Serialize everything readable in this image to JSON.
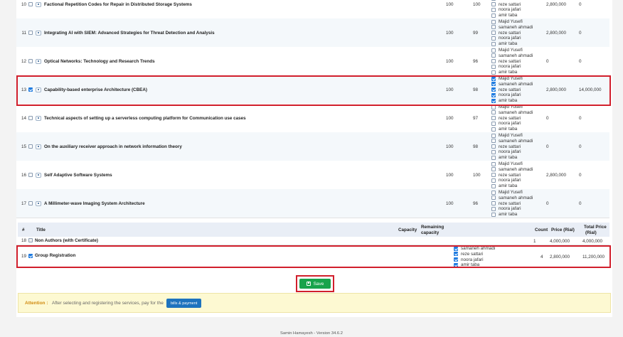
{
  "services": [
    {
      "num": "10",
      "checked": false,
      "title": "Factional Repetition Codes for Repair in Distributed Storage Systems",
      "capacity": "100",
      "remaining": "100",
      "price": "2,800,000",
      "total": "0"
    },
    {
      "num": "11",
      "checked": false,
      "title": "Integrating AI with SIEM: Advanced Strategies for Threat Detection and Analysis",
      "capacity": "100",
      "remaining": "99",
      "price": "2,800,000",
      "total": "0"
    },
    {
      "num": "12",
      "checked": false,
      "title": "Optical Networks: Technology and Research Trends",
      "capacity": "100",
      "remaining": "96",
      "price": "0",
      "total": "0"
    },
    {
      "num": "13",
      "checked": true,
      "title": "Capability-based enterprise Architecture (CBEA)",
      "capacity": "100",
      "remaining": "98",
      "price": "2,800,000",
      "total": "14,000,000"
    },
    {
      "num": "14",
      "checked": false,
      "title": "Technical aspects of setting up a serverless computing platform for Communication use cases",
      "capacity": "100",
      "remaining": "97",
      "price": "0",
      "total": "0"
    },
    {
      "num": "15",
      "checked": false,
      "title": "On the auxiliary receiver approach in network information theory",
      "capacity": "100",
      "remaining": "98",
      "price": "0",
      "total": "0"
    },
    {
      "num": "16",
      "checked": false,
      "title": "Self Adaptive Software Systems",
      "capacity": "100",
      "remaining": "100",
      "price": "2,800,000",
      "total": "0"
    },
    {
      "num": "17",
      "checked": false,
      "title": "A Millimeter-wave Imaging System Architecture",
      "capacity": "100",
      "remaining": "96",
      "price": "0",
      "total": "0"
    }
  ],
  "authors": [
    "Majid Yusefi",
    "samaneh ahmadi",
    "reze sattari",
    "noora jafari",
    "amir taba"
  ],
  "table_header": {
    "num": "#",
    "title": "Title",
    "capacity": "Capacity",
    "remaining_line1": "Remaining",
    "remaining_line2": "capacity",
    "count": "Count",
    "price": "Price (Rial)",
    "total_line1": "Total Price",
    "total_line2": "(Rial)"
  },
  "non_authors": {
    "num": "18",
    "title": "Non Authors (with Certificate)",
    "count": "1",
    "price": "4,000,000",
    "total": "4,000,000"
  },
  "group": {
    "num": "19",
    "title": "Group Registration",
    "members": [
      "samaneh ahmadi",
      "reze sattari",
      "noora jafari",
      "amir taba"
    ],
    "count": "4",
    "price": "2,800,000",
    "total": "11,200,000"
  },
  "save_label": "Save",
  "attention": {
    "label": "Attention :",
    "message": "After selecting and registering the services, pay for the",
    "button": "bills & payment"
  },
  "footer": "Samin Hamayesh - Version 34.6.2",
  "colors": {
    "highlight": "#d11f2c",
    "save": "#18a34b",
    "pay": "#1e73be",
    "attention": "#fdf9d2"
  }
}
